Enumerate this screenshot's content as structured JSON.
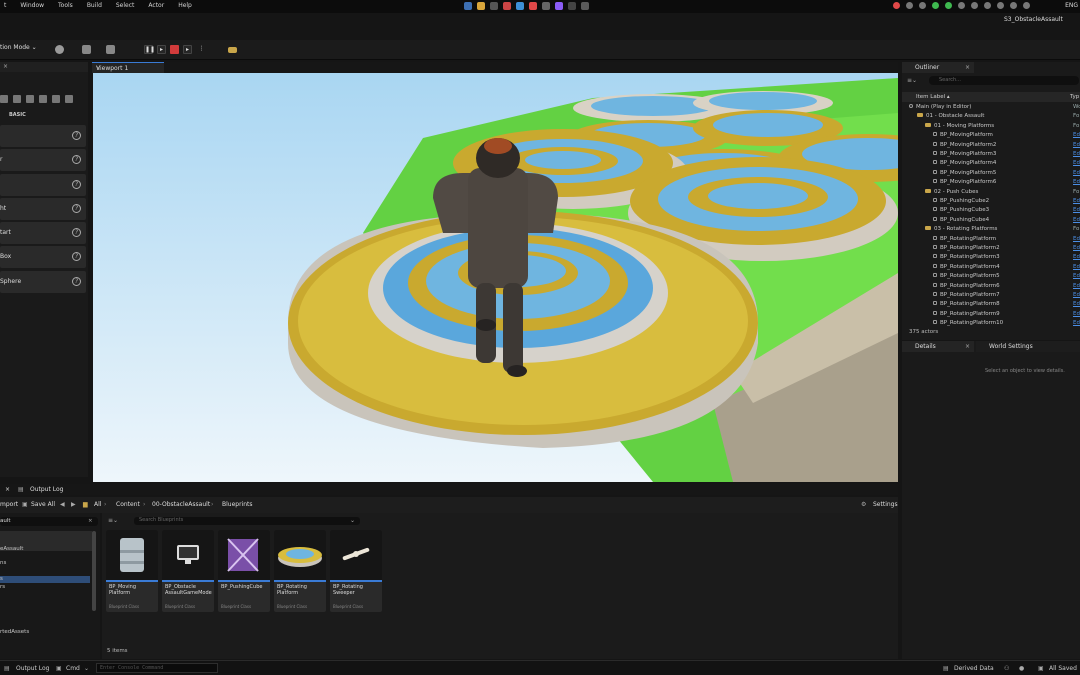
{
  "os_menu": [
    "t",
    "Window",
    "Tools",
    "Build",
    "Select",
    "Actor",
    "Help"
  ],
  "project_name": "S3_ObstacleAssault",
  "language": "ENG",
  "toolbar": {
    "mode_label": "tion Mode",
    "mode_chevron": "⌄"
  },
  "place_actors": {
    "section_label": "BASIC",
    "items": [
      "",
      "r",
      "",
      "ht",
      "tart",
      "Box",
      "Sphere"
    ]
  },
  "viewport": {
    "tab_label": "Viewport 1",
    "close": "×"
  },
  "outliner": {
    "tab_label": "Outliner",
    "search_placeholder": "Search...",
    "col_label": "Item Label ▴",
    "col_type": "Typ",
    "rows": [
      {
        "label": "Main (Play in Editor)",
        "type": "Wo",
        "indent": 0,
        "kind": "world"
      },
      {
        "label": "01 - Obstacle Assault",
        "type": "Fo",
        "indent": 1,
        "kind": "folder"
      },
      {
        "label": "01 - Moving Platforms",
        "type": "Fo",
        "indent": 2,
        "kind": "folder"
      },
      {
        "label": "BP_MovingPlatform",
        "type": "Ed",
        "indent": 3,
        "kind": "bp"
      },
      {
        "label": "BP_MovingPlatform2",
        "type": "Ed",
        "indent": 3,
        "kind": "bp"
      },
      {
        "label": "BP_MovingPlatform3",
        "type": "Ed",
        "indent": 3,
        "kind": "bp"
      },
      {
        "label": "BP_MovingPlatform4",
        "type": "Ed",
        "indent": 3,
        "kind": "bp"
      },
      {
        "label": "BP_MovingPlatform5",
        "type": "Ed",
        "indent": 3,
        "kind": "bp"
      },
      {
        "label": "BP_MovingPlatform6",
        "type": "Ed",
        "indent": 3,
        "kind": "bp"
      },
      {
        "label": "02 - Push Cubes",
        "type": "Fo",
        "indent": 2,
        "kind": "folder"
      },
      {
        "label": "BP_PushingCube2",
        "type": "Ed",
        "indent": 3,
        "kind": "bp"
      },
      {
        "label": "BP_PushingCube3",
        "type": "Ed",
        "indent": 3,
        "kind": "bp"
      },
      {
        "label": "BP_PushingCube4",
        "type": "Ed",
        "indent": 3,
        "kind": "bp"
      },
      {
        "label": "03 - Rotating Platforms",
        "type": "Fo",
        "indent": 2,
        "kind": "folder"
      },
      {
        "label": "BP_RotatingPlatform",
        "type": "Ed",
        "indent": 3,
        "kind": "bp"
      },
      {
        "label": "BP_RotatingPlatform2",
        "type": "Ed",
        "indent": 3,
        "kind": "bp"
      },
      {
        "label": "BP_RotatingPlatform3",
        "type": "Ed",
        "indent": 3,
        "kind": "bp"
      },
      {
        "label": "BP_RotatingPlatform4",
        "type": "Ed",
        "indent": 3,
        "kind": "bp"
      },
      {
        "label": "BP_RotatingPlatform5",
        "type": "Ed",
        "indent": 3,
        "kind": "bp"
      },
      {
        "label": "BP_RotatingPlatform6",
        "type": "Ed",
        "indent": 3,
        "kind": "bp"
      },
      {
        "label": "BP_RotatingPlatform7",
        "type": "Ed",
        "indent": 3,
        "kind": "bp"
      },
      {
        "label": "BP_RotatingPlatform8",
        "type": "Ed",
        "indent": 3,
        "kind": "bp"
      },
      {
        "label": "BP_RotatingPlatform9",
        "type": "Ed",
        "indent": 3,
        "kind": "bp"
      },
      {
        "label": "BP_RotatingPlatform10",
        "type": "Ed",
        "indent": 3,
        "kind": "bp"
      }
    ],
    "actor_count": "375 actors"
  },
  "details": {
    "tab_label": "Details",
    "world_settings_label": "World Settings",
    "hint": "Select an object to view details."
  },
  "content_browser": {
    "tab_label": "Output Log",
    "import_label": "mport",
    "save_all_label": "Save All",
    "breadcrumb": [
      "All",
      "Content",
      "00-ObstacleAssault",
      "Blueprints"
    ],
    "settings_label": "Settings",
    "sidebar_search_text": "ault",
    "sidebar_items": [
      "eAssault",
      "ns",
      "s",
      "rs",
      "rtedAssets"
    ],
    "search_placeholder": "Search Blueprints",
    "assets": [
      {
        "name": "BP_Moving Platform",
        "class": "Blueprint Class",
        "thumb": "cube-stone"
      },
      {
        "name": "BP_Obstacle AssaultGameMode",
        "class": "Blueprint Class",
        "thumb": "monitor"
      },
      {
        "name": "BP_PushingCube",
        "class": "Blueprint Class",
        "thumb": "cube-purple"
      },
      {
        "name": "BP_Rotating Platform",
        "class": "Blueprint Class",
        "thumb": "disc"
      },
      {
        "name": "BP_Rotating Sweeper",
        "class": "Blueprint Class",
        "thumb": "sweeper"
      }
    ],
    "item_count": "5 items"
  },
  "statusbar": {
    "output_log": "Output Log",
    "cmd": "Cmd",
    "console_placeholder": "Enter Console Command",
    "derived_data": "Derived Data",
    "all_saved": "All Saved"
  }
}
